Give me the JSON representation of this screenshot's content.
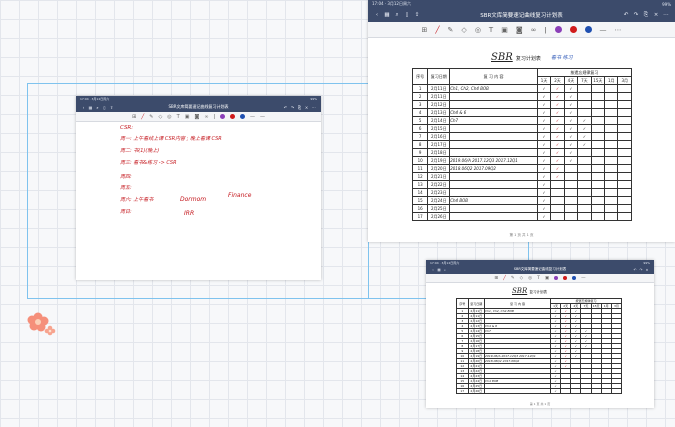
{
  "status_bar": {
    "time": "17:04 · 3月12日周六",
    "battery": "99%"
  },
  "app": {
    "title_left": "SBR文库简要速记曲线复习计划表",
    "title_right": "SBR文库简要速记曲线复习计划表",
    "title_small": "SBR文库简要速记曲线复习计划表"
  },
  "toolbar": {
    "left_icons": [
      "back-icon",
      "grid-icon",
      "search-icon",
      "bookmark-icon",
      "share-icon"
    ],
    "right_icons": [
      "undo-icon",
      "redo-icon",
      "export-icon",
      "close-icon",
      "more-icon"
    ],
    "pen_colors": [
      "#8b3fb8",
      "#d01b1b",
      "#1f4fb0"
    ]
  },
  "notes_page": {
    "heading": "CSR:",
    "lines": [
      "周一: 上午看线上课 CSR内容 ; 晚上看课 CSR",
      "周二: 书(1)(晚上)",
      "周三: 看书&练习 -> CSR",
      "周四:",
      "周五:",
      "周六: 上午看书",
      "周日:"
    ],
    "scribbles": [
      "Dormom",
      "Finance",
      "IRR"
    ]
  },
  "review_sheet": {
    "title": "SBR",
    "title_suffix": "复习计划表",
    "annotation": "看书 练习",
    "header": {
      "col_no": "序号",
      "col_date": "复习日期",
      "col_content": "复 习 内 容",
      "col_review_group": "按遗忘规律复习",
      "review_cols": [
        "1天",
        "2天",
        "4天",
        "7天",
        "15天",
        "1月",
        "3月"
      ]
    },
    "rows": [
      {
        "no": "1",
        "date": "2月11日",
        "content": "Ch1, Ch2, Ch4 BOB",
        "checks": 3
      },
      {
        "no": "2",
        "date": "2月11日",
        "content": "",
        "checks": 3
      },
      {
        "no": "3",
        "date": "2月12日",
        "content": "",
        "checks": 3
      },
      {
        "no": "4",
        "date": "2月13日",
        "content": "Ch4 & 6",
        "checks": 3
      },
      {
        "no": "5",
        "date": "2月14日",
        "content": "Ch7",
        "checks": 4
      },
      {
        "no": "6",
        "date": "2月15日",
        "content": "",
        "checks": 4
      },
      {
        "no": "7",
        "date": "2月16日",
        "content": "",
        "checks": 4
      },
      {
        "no": "8",
        "date": "2月17日",
        "content": "",
        "checks": 4
      },
      {
        "no": "9",
        "date": "2月18日",
        "content": "",
        "checks": 3
      },
      {
        "no": "10",
        "date": "2月19日",
        "content": "2019.06/A  2017.12Q3  2017.12Q1",
        "checks": 3
      },
      {
        "no": "11",
        "date": "2月20日",
        "content": "2018.06Q2  2017.09Q2",
        "checks": 2
      },
      {
        "no": "12",
        "date": "2月21日",
        "content": "",
        "checks": 2
      },
      {
        "no": "13",
        "date": "2月22日",
        "content": "",
        "checks": 1
      },
      {
        "no": "14",
        "date": "2月23日",
        "content": "",
        "checks": 1
      },
      {
        "no": "15",
        "date": "2月24日",
        "content": "Ch4 BOB",
        "checks": 1
      },
      {
        "no": "16",
        "date": "2月25日",
        "content": "",
        "checks": 1
      },
      {
        "no": "17",
        "date": "2月26日",
        "content": "",
        "checks": 1
      }
    ],
    "page_number": "第 1 页 共 1 页"
  }
}
